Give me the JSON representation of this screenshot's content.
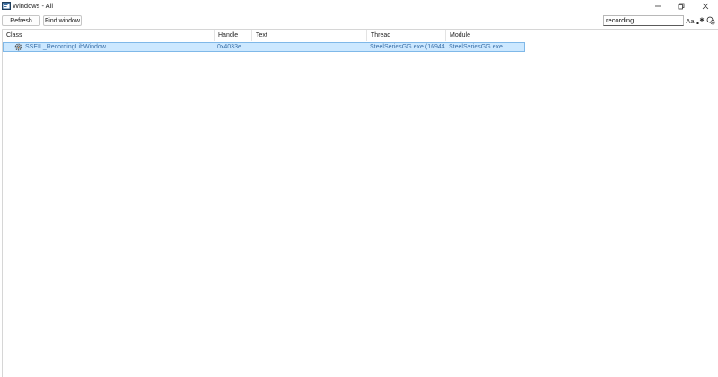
{
  "window": {
    "title": "Windows - All",
    "icon": "window-list-icon"
  },
  "toolbar": {
    "refresh_label": "Refresh",
    "find_window_label": "Find window"
  },
  "search": {
    "value": "recording",
    "case_label": "Aa",
    "regex_icon": "regex-icon",
    "clear_icon": "clear-search-icon"
  },
  "table": {
    "columns": [
      "Class",
      "Handle",
      "Text",
      "Thread",
      "Module"
    ],
    "rows": [
      {
        "icon": "gear-window-icon",
        "class": "SSEIL_RecordingLibWindow",
        "handle": "0x4033e",
        "text": "",
        "thread": "SteelSeriesGG.exe (16944...",
        "module": "SteelSeriesGG.exe",
        "selected": true
      }
    ]
  },
  "colors": {
    "selection_bg": "#cce8ff",
    "selection_border": "#7fb8e8",
    "row_text": "#3b70a8"
  }
}
